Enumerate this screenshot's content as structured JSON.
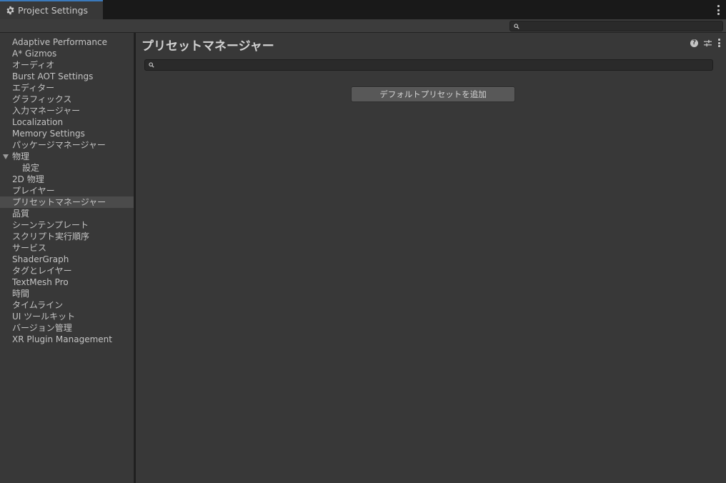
{
  "window": {
    "tab_title": "Project Settings",
    "tab_icon": "gear-icon"
  },
  "toolbar": {
    "search": {
      "value": "",
      "placeholder": ""
    }
  },
  "sidebar": {
    "items": [
      {
        "label": "Adaptive Performance",
        "selected": false,
        "indent": 0
      },
      {
        "label": "A* Gizmos",
        "selected": false,
        "indent": 0
      },
      {
        "label": "オーディオ",
        "selected": false,
        "indent": 0
      },
      {
        "label": "Burst AOT Settings",
        "selected": false,
        "indent": 0
      },
      {
        "label": "エディター",
        "selected": false,
        "indent": 0
      },
      {
        "label": "グラフィックス",
        "selected": false,
        "indent": 0
      },
      {
        "label": "入力マネージャー",
        "selected": false,
        "indent": 0
      },
      {
        "label": "Localization",
        "selected": false,
        "indent": 0
      },
      {
        "label": "Memory Settings",
        "selected": false,
        "indent": 0
      },
      {
        "label": "パッケージマネージャー",
        "selected": false,
        "indent": 0
      },
      {
        "label": "物理",
        "selected": false,
        "indent": 0,
        "expanded": true
      },
      {
        "label": "設定",
        "selected": false,
        "indent": 1
      },
      {
        "label": "2D 物理",
        "selected": false,
        "indent": 0
      },
      {
        "label": "プレイヤー",
        "selected": false,
        "indent": 0
      },
      {
        "label": "プリセットマネージャー",
        "selected": true,
        "indent": 0
      },
      {
        "label": "品質",
        "selected": false,
        "indent": 0
      },
      {
        "label": "シーンテンプレート",
        "selected": false,
        "indent": 0
      },
      {
        "label": "スクリプト実行順序",
        "selected": false,
        "indent": 0
      },
      {
        "label": "サービス",
        "selected": false,
        "indent": 0
      },
      {
        "label": "ShaderGraph",
        "selected": false,
        "indent": 0
      },
      {
        "label": "タグとレイヤー",
        "selected": false,
        "indent": 0
      },
      {
        "label": "TextMesh Pro",
        "selected": false,
        "indent": 0
      },
      {
        "label": "時間",
        "selected": false,
        "indent": 0
      },
      {
        "label": "タイムライン",
        "selected": false,
        "indent": 0
      },
      {
        "label": "UI ツールキット",
        "selected": false,
        "indent": 0
      },
      {
        "label": "バージョン管理",
        "selected": false,
        "indent": 0
      },
      {
        "label": "XR Plugin Management",
        "selected": false,
        "indent": 0
      }
    ]
  },
  "main": {
    "title": "プリセットマネージャー",
    "header_icons": [
      "help-icon",
      "presets-icon",
      "more-options-icon"
    ],
    "search": {
      "value": "",
      "placeholder": ""
    },
    "add_default_preset_label": "デフォルトプリセットを追加"
  },
  "colors": {
    "accent": "#3a79bb",
    "background": "#383838",
    "titlebar": "#191919",
    "selected_item": "#4b4b4b",
    "button": "#585858"
  }
}
